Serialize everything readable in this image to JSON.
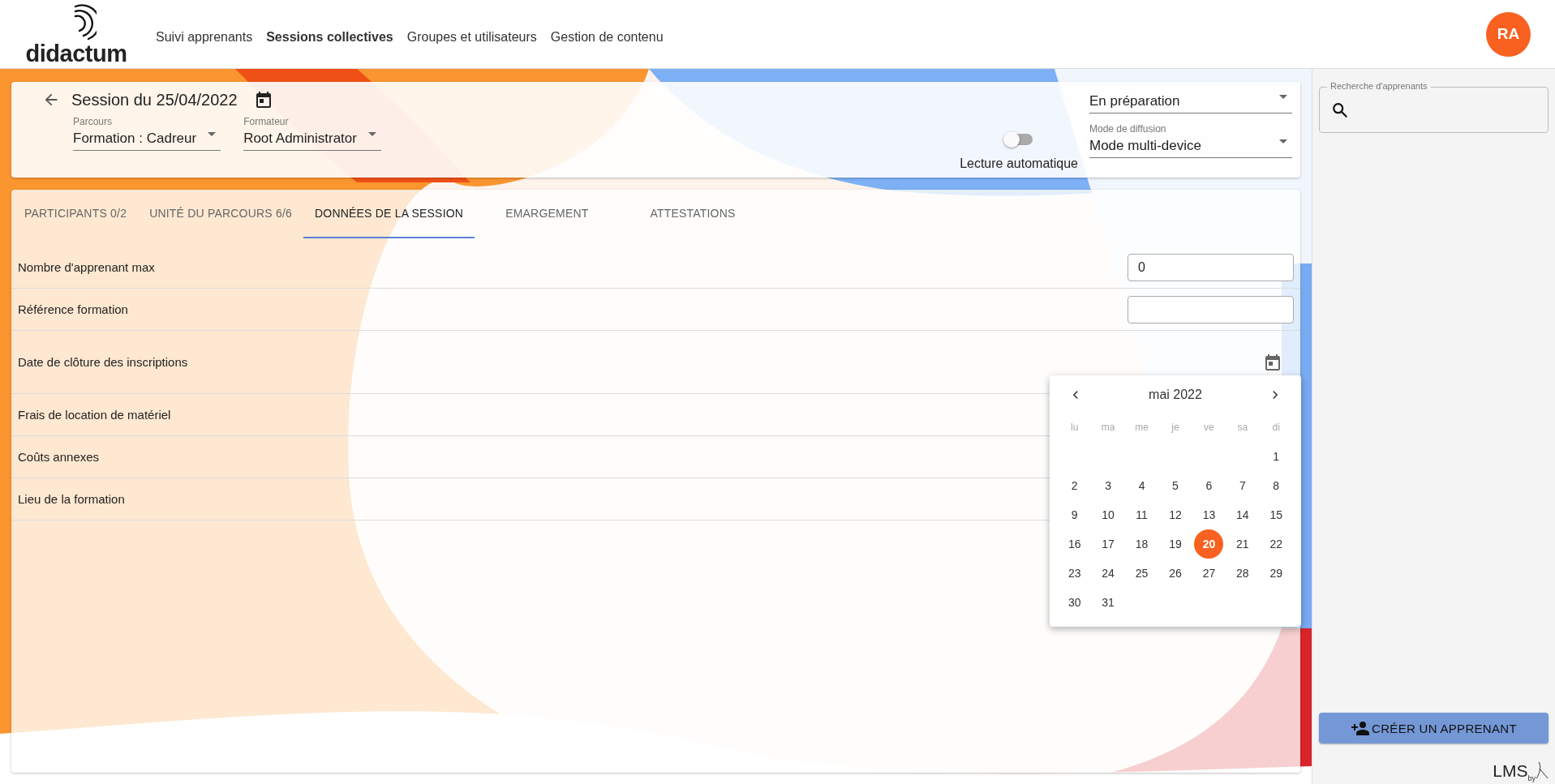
{
  "header": {
    "logo": "didactum",
    "nav": [
      {
        "label": "Suivi apprenants",
        "selected": false
      },
      {
        "label": "Sessions collectives",
        "selected": true
      },
      {
        "label": "Groupes et utilisateurs",
        "selected": false
      },
      {
        "label": "Gestion de contenu",
        "selected": false
      }
    ],
    "avatar": "RA"
  },
  "session": {
    "title": "Session du 25/04/2022",
    "parcours": {
      "label": "Parcours",
      "value": "Formation : Cadreur"
    },
    "formateur": {
      "label": "Formateur",
      "value": "Root Administrator"
    },
    "autoplay": {
      "label": "Lecture automatique",
      "on": false
    },
    "status": {
      "value": "En préparation"
    },
    "diffusion": {
      "label": "Mode de diffusion",
      "value": "Mode multi-device"
    }
  },
  "tabs": [
    {
      "label": "PARTICIPANTS 0/2",
      "selected": false
    },
    {
      "label": "UNITÉ DU PARCOURS 6/6",
      "selected": false
    },
    {
      "label": "DONNÉES DE LA SESSION",
      "selected": true
    },
    {
      "label": "EMARGEMENT",
      "selected": false
    },
    {
      "label": "ATTESTATIONS",
      "selected": false
    }
  ],
  "fields": [
    {
      "label": "Nombre d'apprenant max",
      "kind": "input",
      "value": "0"
    },
    {
      "label": "Référence formation",
      "kind": "input"
    },
    {
      "label": "Date de clôture des inscriptions",
      "kind": "date"
    },
    {
      "label": "Frais de location de matériel",
      "kind": "none"
    },
    {
      "label": "Coûts annexes",
      "kind": "none"
    },
    {
      "label": "Lieu de la formation",
      "kind": "none"
    }
  ],
  "calendar": {
    "month": "mai 2022",
    "weekdays": [
      "lu",
      "ma",
      "me",
      "je",
      "ve",
      "sa",
      "di"
    ],
    "weeks": [
      {
        "days": [
          {
            "day": "1",
            "selected": false
          }
        ]
      },
      {
        "days": [
          {
            "day": "2",
            "selected": false
          },
          {
            "day": "3",
            "selected": false
          },
          {
            "day": "4",
            "selected": false
          },
          {
            "day": "5",
            "selected": false
          },
          {
            "day": "6",
            "selected": false
          },
          {
            "day": "7",
            "selected": false
          },
          {
            "day": "8",
            "selected": false
          }
        ]
      },
      {
        "days": [
          {
            "day": "9",
            "selected": false
          },
          {
            "day": "10",
            "selected": false
          },
          {
            "day": "11",
            "selected": false
          },
          {
            "day": "12",
            "selected": false
          },
          {
            "day": "13",
            "selected": false
          },
          {
            "day": "14",
            "selected": false
          },
          {
            "day": "15",
            "selected": false
          }
        ]
      },
      {
        "days": [
          {
            "day": "16",
            "selected": false
          },
          {
            "day": "17",
            "selected": false
          },
          {
            "day": "18",
            "selected": false
          },
          {
            "day": "19",
            "selected": false
          },
          {
            "day": "20",
            "selected": true
          },
          {
            "day": "21",
            "selected": false
          },
          {
            "day": "22",
            "selected": false
          }
        ]
      },
      {
        "days": [
          {
            "day": "23",
            "selected": false
          },
          {
            "day": "24",
            "selected": false
          },
          {
            "day": "25",
            "selected": false
          },
          {
            "day": "26",
            "selected": false
          },
          {
            "day": "27",
            "selected": false
          },
          {
            "day": "28",
            "selected": false
          },
          {
            "day": "29",
            "selected": false
          }
        ]
      },
      {
        "days": [
          {
            "day": "30",
            "selected": false
          },
          {
            "day": "31",
            "selected": false
          }
        ]
      }
    ]
  },
  "sidebar": {
    "search": {
      "label": "Recherche d'apprenants"
    },
    "create_button": "CRÉER UN APPRENANT",
    "brand": {
      "text": "LMS",
      "sub": "by"
    }
  }
}
